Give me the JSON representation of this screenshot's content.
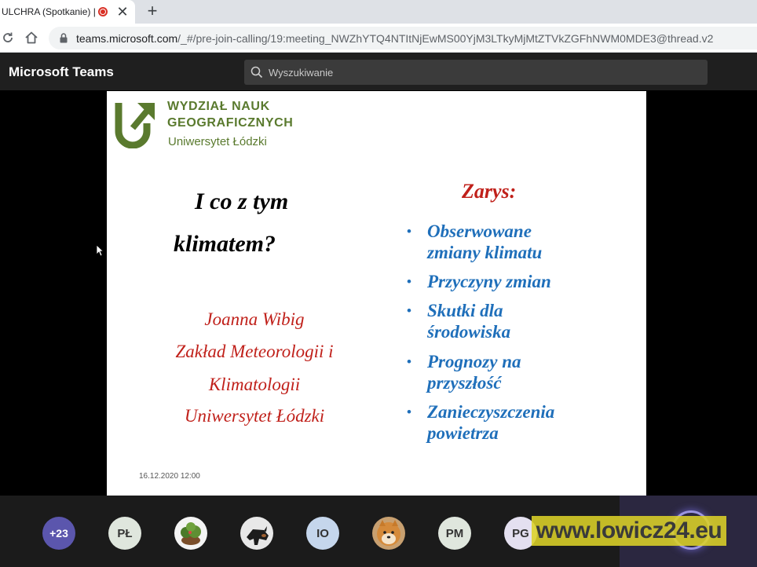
{
  "browser": {
    "tab_title": "ULCHRA (Spotkanie) | M",
    "tab_close": "✕",
    "new_tab": "+",
    "url_host": "teams.microsoft.com",
    "url_path": "/_#/pre-join-calling/19:meeting_NWZhYTQ4NTItNjEwMS00YjM3LTkyMjMtZTVkZGFhNWM0MDE3@thread.v2"
  },
  "teams": {
    "app_title": "Microsoft Teams",
    "search_placeholder": "Wyszukiwanie"
  },
  "slide": {
    "logo_line1": "WYDZIAŁ NAUK",
    "logo_line2": "GEOGRAFICZNYCH",
    "logo_line3": "Uniwersytet Łódzki",
    "title_line1": "I co z tym",
    "title_line2": "klimatem?",
    "author_name": "Joanna Wibig",
    "author_dept1": "Zakład Meteorologii i",
    "author_dept2": "Klimatologii",
    "author_univ": "Uniwersytet Łódzki",
    "outline_heading": "Zarys:",
    "outline_items": [
      {
        "line1": "Obserwowane",
        "line2": "zmiany klimatu"
      },
      {
        "line1": "Przyczyny zmian",
        "line2": ""
      },
      {
        "line1": "Skutki dla",
        "line2": "środowiska"
      },
      {
        "line1": "Prognozy na",
        "line2": "przyszłość"
      },
      {
        "line1": "Zanieczyszczenia",
        "line2": "powietrza"
      }
    ],
    "bullet": "•",
    "date": "16.12.2020 12:00"
  },
  "participants": {
    "more": "+23",
    "initials_1": "PŁ",
    "initials_2": "IO",
    "initials_3": "PM",
    "initials_4": "PG"
  },
  "watermark": "www.lowicz24.eu"
}
